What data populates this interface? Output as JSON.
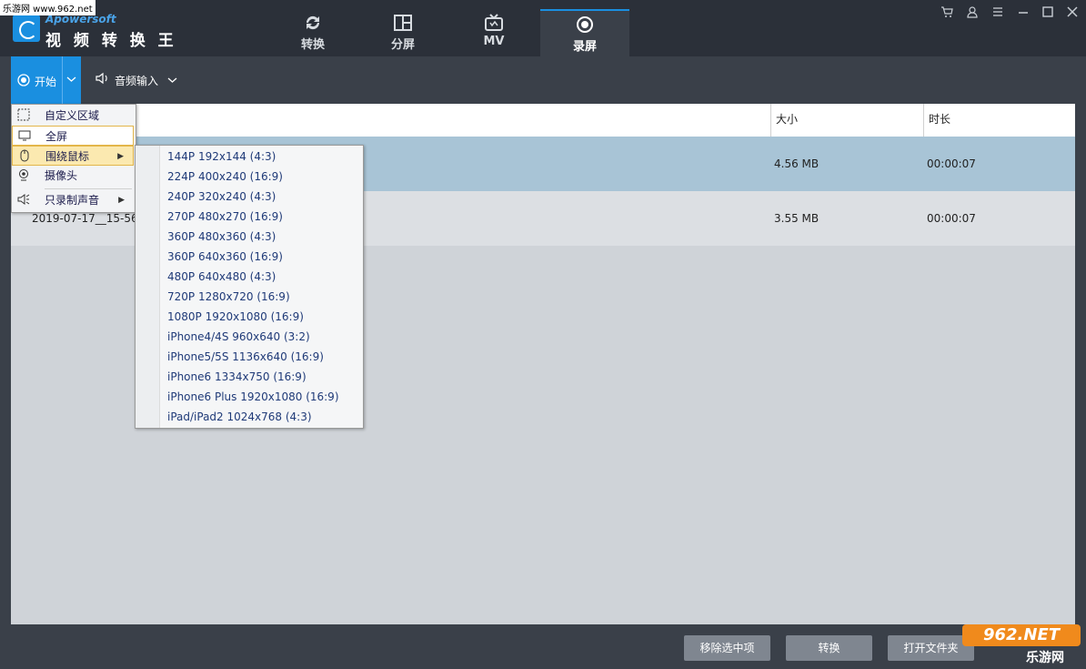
{
  "watermark_top": "乐游网 www.962.net",
  "app": {
    "brand": "Apowersoft",
    "name": "视 频 转 换 王"
  },
  "tabs": [
    {
      "label": "转换",
      "icon": "refresh-icon"
    },
    {
      "label": "分屏",
      "icon": "split-screen-icon"
    },
    {
      "label": "MV",
      "icon": "tv-icon"
    },
    {
      "label": "录屏",
      "icon": "record-icon",
      "active": true
    }
  ],
  "window_controls": [
    "cart-icon",
    "user-icon",
    "menu-icon",
    "minimize-icon",
    "maximize-icon",
    "close-icon"
  ],
  "toolbar": {
    "start_label": "开始",
    "audio_label": "音频输入"
  },
  "table": {
    "columns": [
      "大小",
      "时长"
    ],
    "rows": [
      {
        "name": "",
        "size": "4.56 MB",
        "duration": "00:00:07",
        "selected": true
      },
      {
        "name": "2019-07-17__15-56-",
        "size": "3.55 MB",
        "duration": "00:00:07",
        "selected": false
      }
    ]
  },
  "record_menu": [
    {
      "label": "自定义区域",
      "icon": "region-icon"
    },
    {
      "label": "全屏",
      "icon": "monitor-icon"
    },
    {
      "label": "围绕鼠标",
      "icon": "mouse-icon",
      "submenu": true
    },
    {
      "label": "摄像头",
      "icon": "webcam-icon"
    },
    {
      "label": "只录制声音",
      "icon": "speaker-icon",
      "submenu": true
    }
  ],
  "resolution_menu": [
    "144P 192x144 (4:3)",
    "224P 400x240 (16:9)",
    "240P 320x240 (4:3)",
    "270P 480x270 (16:9)",
    "360P 480x360 (4:3)",
    "360P 640x360 (16:9)",
    "480P 640x480 (4:3)",
    "720P 1280x720 (16:9)",
    "1080P 1920x1080 (16:9)",
    "iPhone4/4S 960x640 (3:2)",
    "iPhone5/5S 1136x640 (16:9)",
    "iPhone6 1334x750 (16:9)",
    "iPhone6 Plus 1920x1080 (16:9)",
    "iPad/iPad2 1024x768 (4:3)"
  ],
  "bottom_buttons": {
    "remove": "移除选中项",
    "convert": "转换",
    "open_folder": "打开文件夹"
  },
  "watermark_bottom": {
    "logo": "962.NET",
    "text": "乐游网"
  },
  "colors": {
    "accent": "#1a8fe0",
    "selected_row": "#a8c4d6",
    "titlebar": "#2b3039"
  }
}
